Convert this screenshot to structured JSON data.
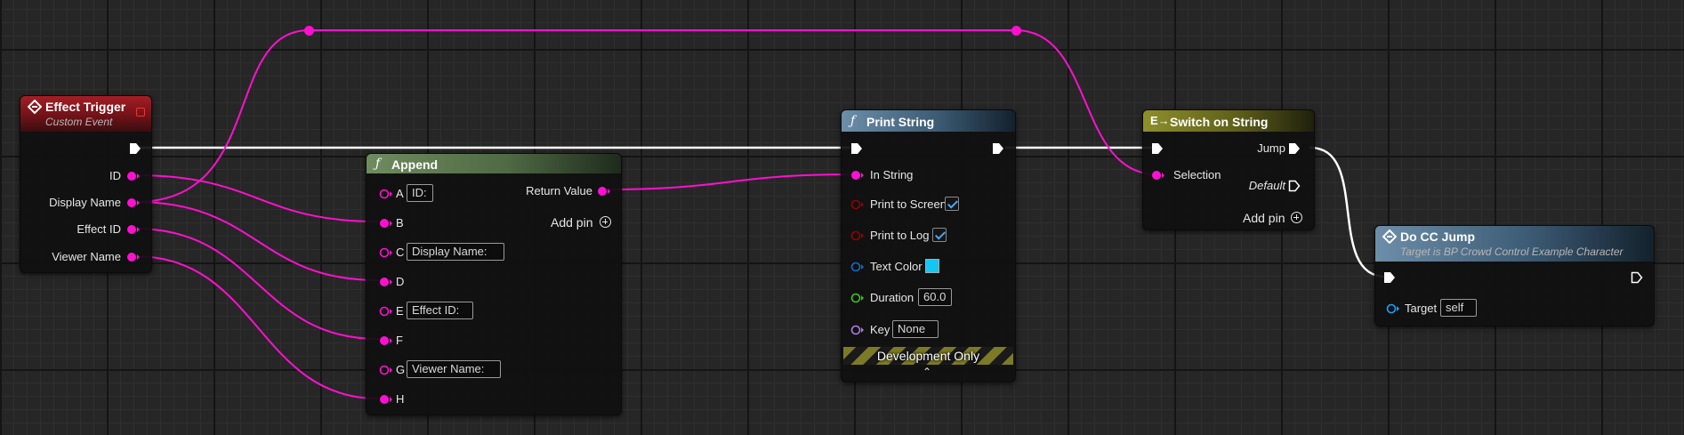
{
  "colors": {
    "string_pin": "#ff10d0",
    "bool_pin": "#950000",
    "struct_pin": "#0d6ece",
    "float_pin": "#3ec418",
    "key_pin": "#b27ae8",
    "object_pin": "#1aa3ff",
    "exec": "#ffffff",
    "text_color_swatch": "#14c6f2"
  },
  "nodes": {
    "effect_trigger": {
      "title": "Effect Trigger",
      "subtitle": "Custom Event",
      "icon": "event-diamond-icon",
      "outputs": [
        "ID",
        "Display Name",
        "Effect ID",
        "Viewer Name"
      ]
    },
    "append": {
      "title": "Append",
      "icon": "function-icon",
      "inputs": [
        {
          "name": "A",
          "value": "ID:"
        },
        {
          "name": "B",
          "value": ""
        },
        {
          "name": "C",
          "value": "Display Name:"
        },
        {
          "name": "D",
          "value": ""
        },
        {
          "name": "E",
          "value": "Effect ID:"
        },
        {
          "name": "F",
          "value": ""
        },
        {
          "name": "G",
          "value": "Viewer Name:"
        },
        {
          "name": "H",
          "value": ""
        }
      ],
      "output": "Return Value",
      "add_pin": "Add pin"
    },
    "print_string": {
      "title": "Print String",
      "icon": "function-icon",
      "in_string": "In String",
      "print_to_screen": "Print to Screen",
      "print_to_screen_checked": true,
      "print_to_log": "Print to Log",
      "print_to_log_checked": true,
      "text_color": "Text Color",
      "duration": "Duration",
      "duration_value": "60.0",
      "key": "Key",
      "key_value": "None",
      "dev_only": "Development Only",
      "collapse_icon": "chevron-up-icon"
    },
    "switch_on_string": {
      "title": "Switch on String",
      "icon": "switch-icon",
      "selection": "Selection",
      "out_jump": "Jump",
      "out_default": "Default",
      "add_pin": "Add pin"
    },
    "do_cc_jump": {
      "title": "Do CC Jump",
      "subtitle": "Target is BP Crowd Control Example Character",
      "icon": "function-icon",
      "target": "Target",
      "target_value": "self"
    }
  }
}
